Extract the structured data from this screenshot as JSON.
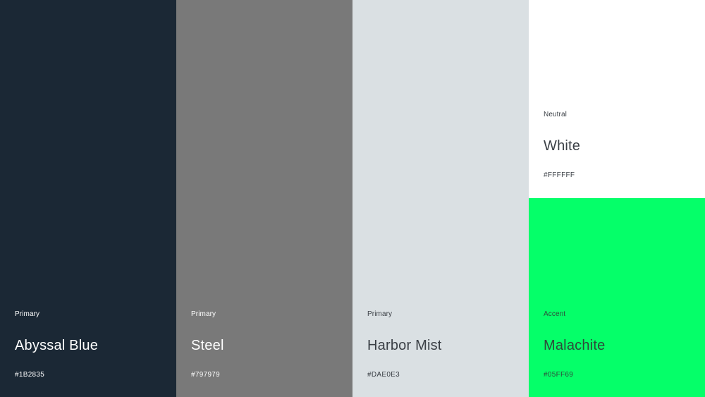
{
  "swatches": [
    {
      "role": "Primary",
      "name": "Abyssal Blue",
      "hex": "#1B2835",
      "color": "#1b2835"
    },
    {
      "role": "Primary",
      "name": "Steel",
      "hex": "#797979",
      "color": "#797979"
    },
    {
      "role": "Primary",
      "name": "Harbor Mist",
      "hex": "#DAE0E3",
      "color": "#dae0e3"
    },
    {
      "role": "Neutral",
      "name": "White",
      "hex": "#FFFFFF",
      "color": "#ffffff"
    },
    {
      "role": "Accent",
      "name": "Malachite",
      "hex": "#05FF69",
      "color": "#05ff69"
    }
  ]
}
